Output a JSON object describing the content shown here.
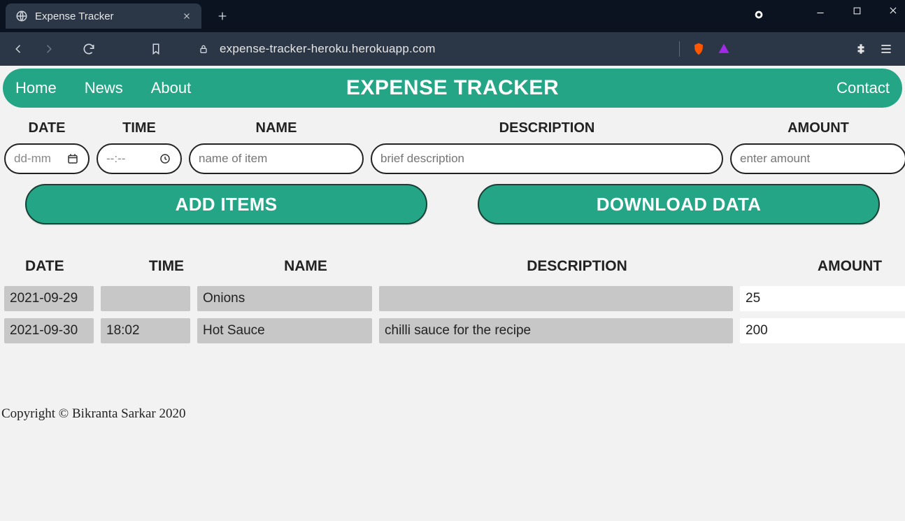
{
  "browser": {
    "tab_title": "Expense Tracker",
    "url": "expense-tracker-heroku.herokuapp.com"
  },
  "navbar": {
    "brand": "EXPENSE TRACKER",
    "links": {
      "home": "Home",
      "news": "News",
      "about": "About",
      "contact": "Contact"
    }
  },
  "form": {
    "labels": {
      "date": "DATE",
      "time": "TIME",
      "name": "NAME",
      "description": "DESCRIPTION",
      "amount": "AMOUNT"
    },
    "placeholders": {
      "date": "dd-mm",
      "time": "--:--",
      "name": "name of item",
      "description": "brief description",
      "amount": "enter amount"
    }
  },
  "actions": {
    "add": "ADD ITEMS",
    "download": "DOWNLOAD DATA"
  },
  "table": {
    "headers": {
      "date": "DATE",
      "time": "TIME",
      "name": "NAME",
      "description": "DESCRIPTION",
      "amount": "AMOUNT"
    },
    "rows": [
      {
        "date": "2021-09-29",
        "time": "",
        "name": "Onions",
        "description": "",
        "amount": "25"
      },
      {
        "date": "2021-09-30",
        "time": "18:02",
        "name": "Hot Sauce",
        "description": "chilli sauce for the recipe",
        "amount": "200"
      }
    ]
  },
  "footer": "Copyright © Bikranta Sarkar 2020"
}
